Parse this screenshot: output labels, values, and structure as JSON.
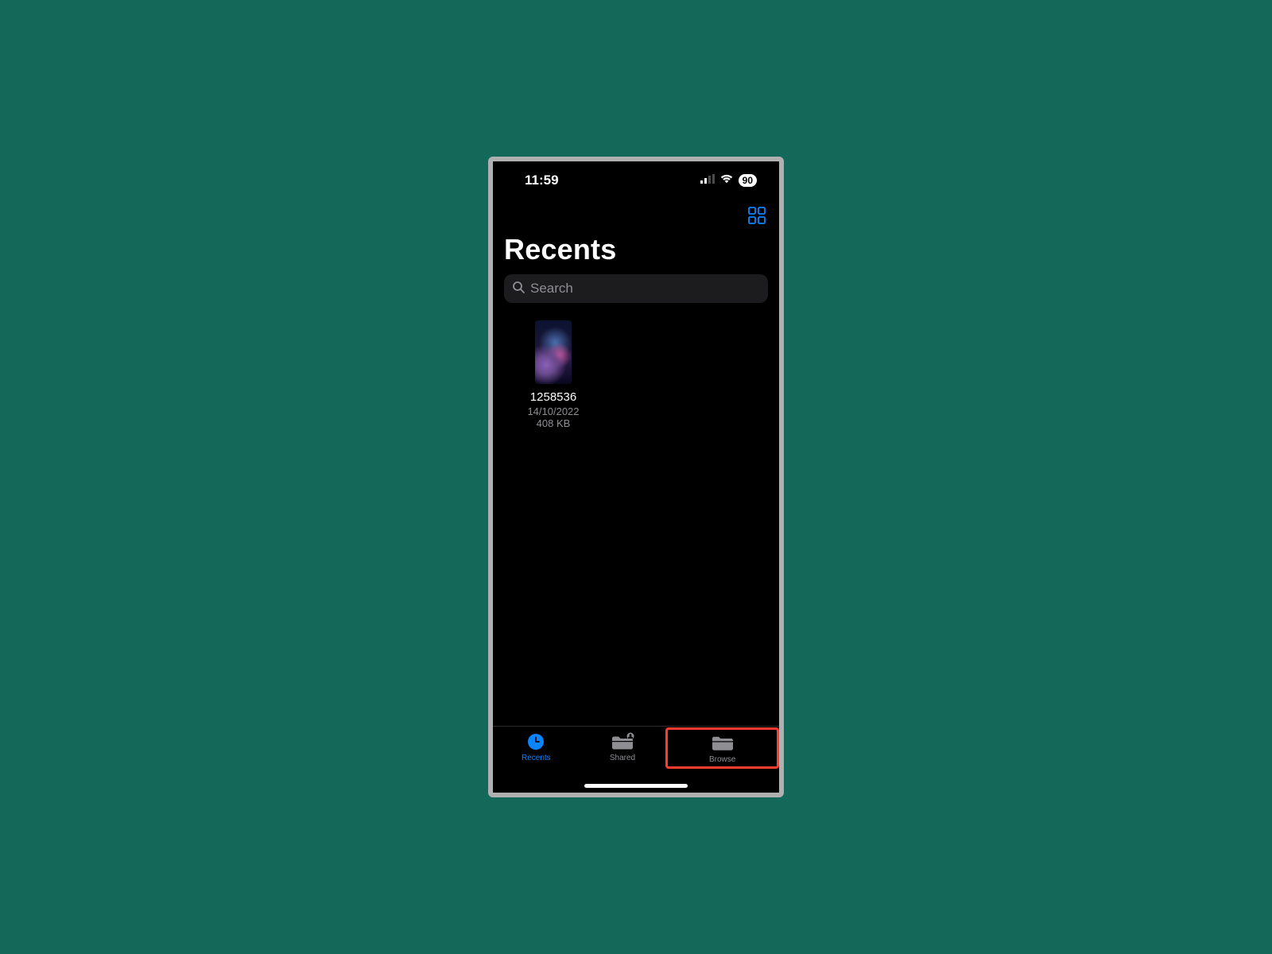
{
  "statusbar": {
    "time": "11:59",
    "battery": "90"
  },
  "header": {
    "title": "Recents"
  },
  "search": {
    "placeholder": "Search"
  },
  "files": [
    {
      "name": "1258536",
      "date": "14/10/2022",
      "size": "408 KB"
    }
  ],
  "tabs": {
    "recents": "Recents",
    "shared": "Shared",
    "browse": "Browse"
  },
  "colors": {
    "accent": "#0a84ff",
    "highlight": "#ff3b30"
  }
}
